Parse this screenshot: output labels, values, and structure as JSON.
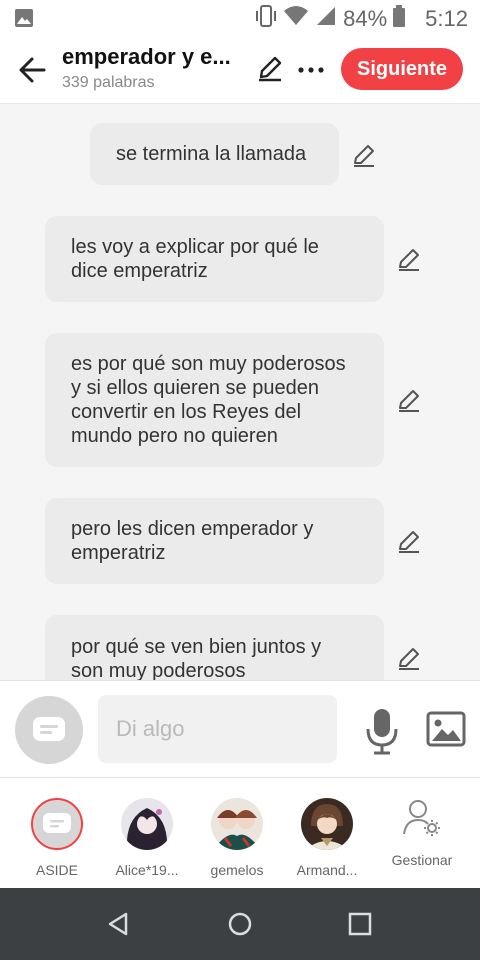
{
  "status_bar": {
    "battery": "84%",
    "time": "5:12"
  },
  "header": {
    "title": "emperador y e...",
    "subtitle": "339 palabras",
    "next_label": "Siguiente"
  },
  "messages": [
    {
      "text": "se termina la llamada"
    },
    {
      "text": "les voy a explicar por qué le dice emperatriz"
    },
    {
      "text": "es por qué son muy poderosos y si ellos quieren se pueden convertir en los Reyes del mundo pero no quieren"
    },
    {
      "text": "pero les dicen emperador y emperatriz"
    },
    {
      "text": "por qué se ven bien juntos y son muy poderosos"
    }
  ],
  "composer": {
    "placeholder": "Di algo"
  },
  "characters": [
    {
      "label": "ASIDE"
    },
    {
      "label": "Alice*19..."
    },
    {
      "label": "gemelos"
    },
    {
      "label": "Armand..."
    },
    {
      "label": "Gestionar"
    }
  ],
  "colors": {
    "accent": "#f24144",
    "bubble": "#ebebeb",
    "nav": "#3c4043"
  }
}
